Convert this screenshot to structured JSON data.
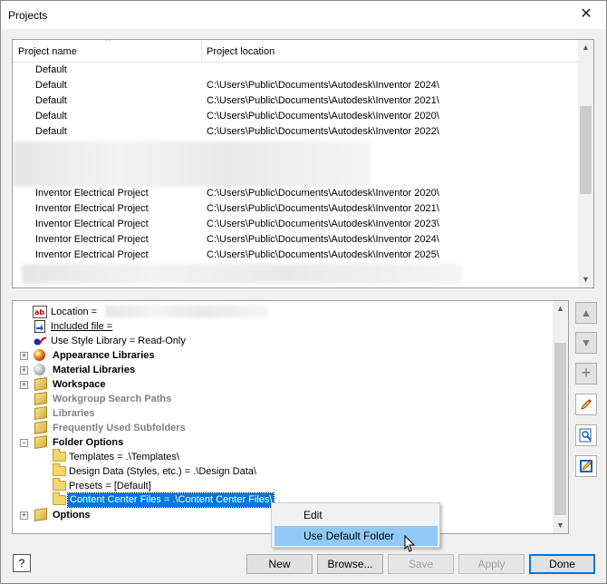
{
  "window": {
    "title": "Projects",
    "close_glyph": "✕"
  },
  "project_list": {
    "columns": [
      "Project name",
      "Project location"
    ],
    "rows": [
      {
        "name": "Default",
        "location": ""
      },
      {
        "name": "Default",
        "location": "C:\\Users\\Public\\Documents\\Autodesk\\Inventor 2024\\"
      },
      {
        "name": "Default",
        "location": "C:\\Users\\Public\\Documents\\Autodesk\\Inventor 2021\\"
      },
      {
        "name": "Default",
        "location": "C:\\Users\\Public\\Documents\\Autodesk\\Inventor 2020\\"
      },
      {
        "name": "Default",
        "location": "C:\\Users\\Public\\Documents\\Autodesk\\Inventor 2022\\"
      },
      {
        "name": "Inventor Electrical Project",
        "location": "C:\\Users\\Public\\Documents\\Autodesk\\Inventor 2020\\"
      },
      {
        "name": "Inventor Electrical Project",
        "location": "C:\\Users\\Public\\Documents\\Autodesk\\Inventor 2021\\"
      },
      {
        "name": "Inventor Electrical Project",
        "location": "C:\\Users\\Public\\Documents\\Autodesk\\Inventor 2023\\"
      },
      {
        "name": "Inventor Electrical Project",
        "location": "C:\\Users\\Public\\Documents\\Autodesk\\Inventor 2024\\"
      },
      {
        "name": "Inventor Electrical Project",
        "location": "C:\\Users\\Public\\Documents\\Autodesk\\Inventor 2025\\"
      }
    ]
  },
  "tree": {
    "location": "Location =",
    "included_file": "Included file =",
    "style_library": "Use Style Library = Read-Only",
    "appearance": "Appearance Libraries",
    "material": "Material Libraries",
    "workspace": "Workspace",
    "workgroup": "Workgroup Search Paths",
    "libraries": "Libraries",
    "frequent": "Frequently Used Subfolders",
    "folder_options": "Folder Options",
    "templates": "Templates = .\\Templates\\",
    "design_data": "Design Data (Styles, etc.) = .\\Design Data\\",
    "presets": "Presets = [Default]",
    "content_center": "Content Center Files = .\\Content Center Files\\",
    "options": "Options"
  },
  "context_menu": {
    "edit": "Edit",
    "use_default": "Use Default Folder"
  },
  "buttons": {
    "help": "?",
    "new": "New",
    "browse": "Browse...",
    "save": "Save",
    "apply": "Apply",
    "done": "Done"
  },
  "glyphs": {
    "expand": "+",
    "collapse": "−",
    "up": "▲",
    "down": "▼",
    "add": "+",
    "sort": "^"
  }
}
